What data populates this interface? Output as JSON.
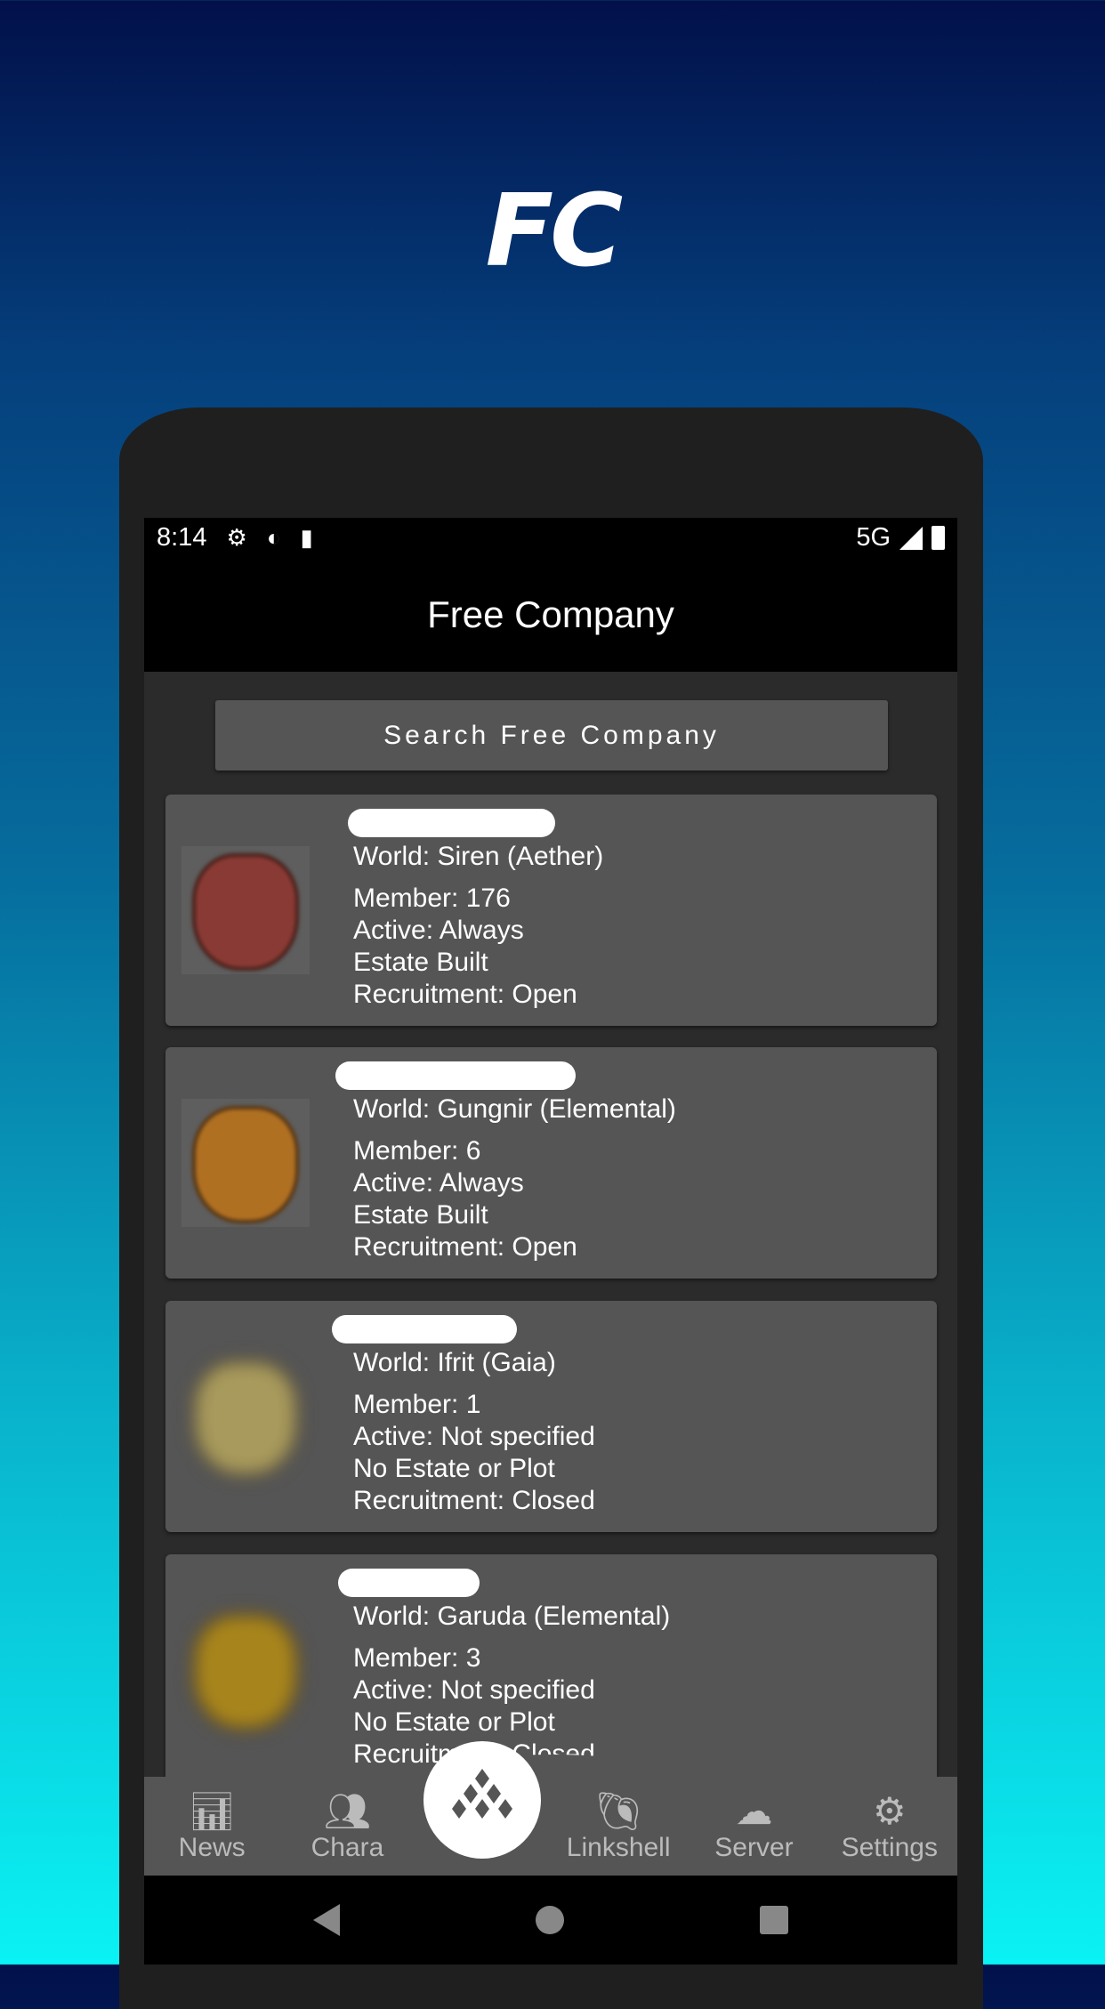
{
  "promo_title": "FC",
  "status_bar": {
    "time": "8:14",
    "network": "5G",
    "icons": [
      "settings-wifi-icon",
      "pocket-icon",
      "sd-card-icon",
      "signal-icon",
      "battery-icon"
    ]
  },
  "app_bar": {
    "title": "Free Company"
  },
  "search_button": "Search Free Company",
  "companies": [
    {
      "world": "World: Siren (Aether)",
      "member": "Member: 176",
      "active": "Active: Always",
      "estate": "Estate Built",
      "recruitment": "Recruitment: Open",
      "emblem_color": "#8a3a34"
    },
    {
      "world": "World: Gungnir (Elemental)",
      "member": "Member: 6",
      "active": "Active: Always",
      "estate": "Estate Built",
      "recruitment": "Recruitment: Open",
      "emblem_color": "#b07022"
    },
    {
      "world": "World: Ifrit (Gaia)",
      "member": "Member: 1",
      "active": "Active: Not specified",
      "estate": "No Estate or Plot",
      "recruitment": "Recruitment: Closed",
      "emblem_color": "#a89a5c"
    },
    {
      "world": "World: Garuda (Elemental)",
      "member": "Member: 3",
      "active": "Active: Not specified",
      "estate": "No Estate or Plot",
      "recruitment": "Recruitment: Closed",
      "emblem_color": "#a8851c"
    }
  ],
  "bottom_nav": [
    {
      "label": "News",
      "icon": "news-chart-icon"
    },
    {
      "label": "Chara",
      "icon": "people-icon"
    },
    {
      "label": "",
      "icon": "fc-diamonds-icon",
      "active": true
    },
    {
      "label": "Linkshell",
      "icon": "shell-icon"
    },
    {
      "label": "Server",
      "icon": "cloud-icon"
    },
    {
      "label": "Settings",
      "icon": "gear-icon"
    }
  ],
  "colors": {
    "card": "#555555",
    "background": "#2b2b2b",
    "appbar": "#000000"
  }
}
